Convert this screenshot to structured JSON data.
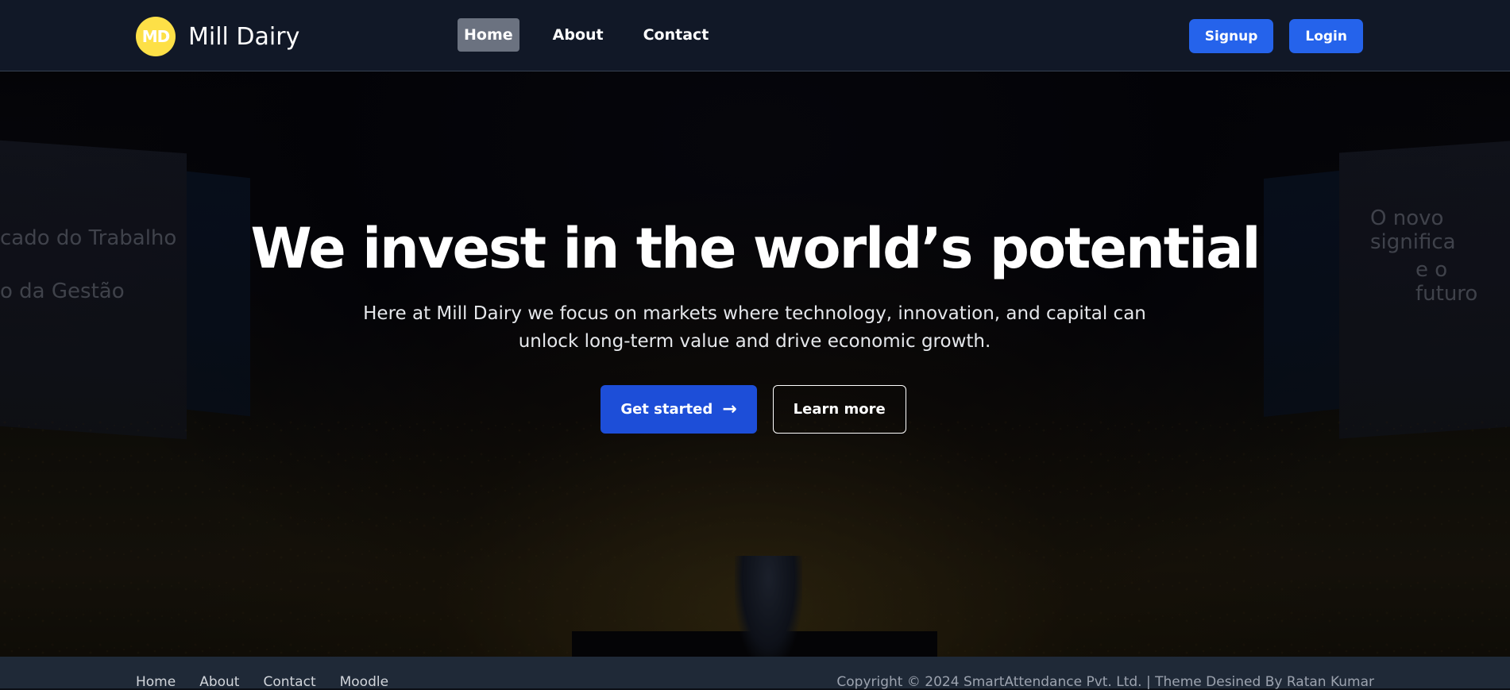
{
  "navbar": {
    "logo_initials": "MD",
    "brand_name": "Mill Dairy",
    "links": [
      {
        "label": "Home",
        "active": true
      },
      {
        "label": "About",
        "active": false
      },
      {
        "label": "Contact",
        "active": false
      }
    ],
    "signup_label": "Signup",
    "login_label": "Login"
  },
  "hero": {
    "background_text": {
      "left_top": "cado do Trabalho",
      "left_bottom": "o da Gestão",
      "right_top": "O novo significa",
      "right_bottom": "e o futuro"
    },
    "title": "We invest in the world’s potential",
    "subtitle": "Here at Mill Dairy we focus on markets where technology, innovation, and capital can unlock long-term value and drive economic growth.",
    "primary_button": "Get started",
    "primary_button_icon": "→",
    "secondary_button": "Learn more"
  },
  "footer": {
    "links": [
      "Home",
      "About",
      "Contact",
      "Moodle"
    ],
    "copyright": "Copyright © 2024 SmartAttendance Pvt. Ltd. | Theme Desined By Ratan Kumar"
  },
  "colors": {
    "navbar_bg": "#111827",
    "logo_bg": "#fde047",
    "accent": "#2563eb",
    "footer_bg": "#1f2937"
  }
}
